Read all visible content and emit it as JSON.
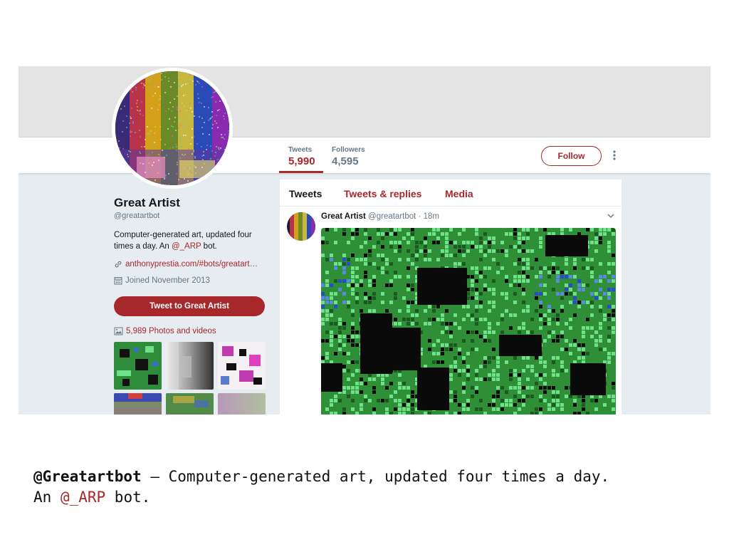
{
  "profile": {
    "name": "Great Artist",
    "handle": "@greatartbot",
    "bio_text": "Computer-generated art, updated four times a day. An ",
    "bio_mention": "@_ARP",
    "bio_suffix": " bot.",
    "link": "anthonyprestia.com/#bots/greatart…",
    "joined": "Joined November 2013",
    "tweet_to_label": "Tweet to Great Artist",
    "photos_label": "5,989 Photos and videos"
  },
  "stats": {
    "tweets_label": "Tweets",
    "tweets_value": "5,990",
    "followers_label": "Followers",
    "followers_value": "4,595"
  },
  "actions": {
    "follow_label": "Follow"
  },
  "feed": {
    "tabs": [
      {
        "label": "Tweets",
        "active": true
      },
      {
        "label": "Tweets & replies",
        "active": false
      },
      {
        "label": "Media",
        "active": false
      }
    ],
    "tweet": {
      "name": "Great Artist",
      "handle": "@greatartbot",
      "separator": " · ",
      "time": "18m"
    }
  },
  "caption": {
    "handle": "@Greatartbot",
    "text": " – Computer-generated art, updated four times a day.",
    "line2_prefix": "An ",
    "mention": "@_ARP",
    "line2_suffix": " bot."
  },
  "colors": {
    "accent": "#a7282b",
    "text_muted": "#657786",
    "banner": "#e4e4e4",
    "background": "#e6ecf0"
  },
  "icons": [
    "link-icon",
    "calendar-icon",
    "image-icon",
    "chevron-down-icon",
    "more-vertical-icon"
  ]
}
